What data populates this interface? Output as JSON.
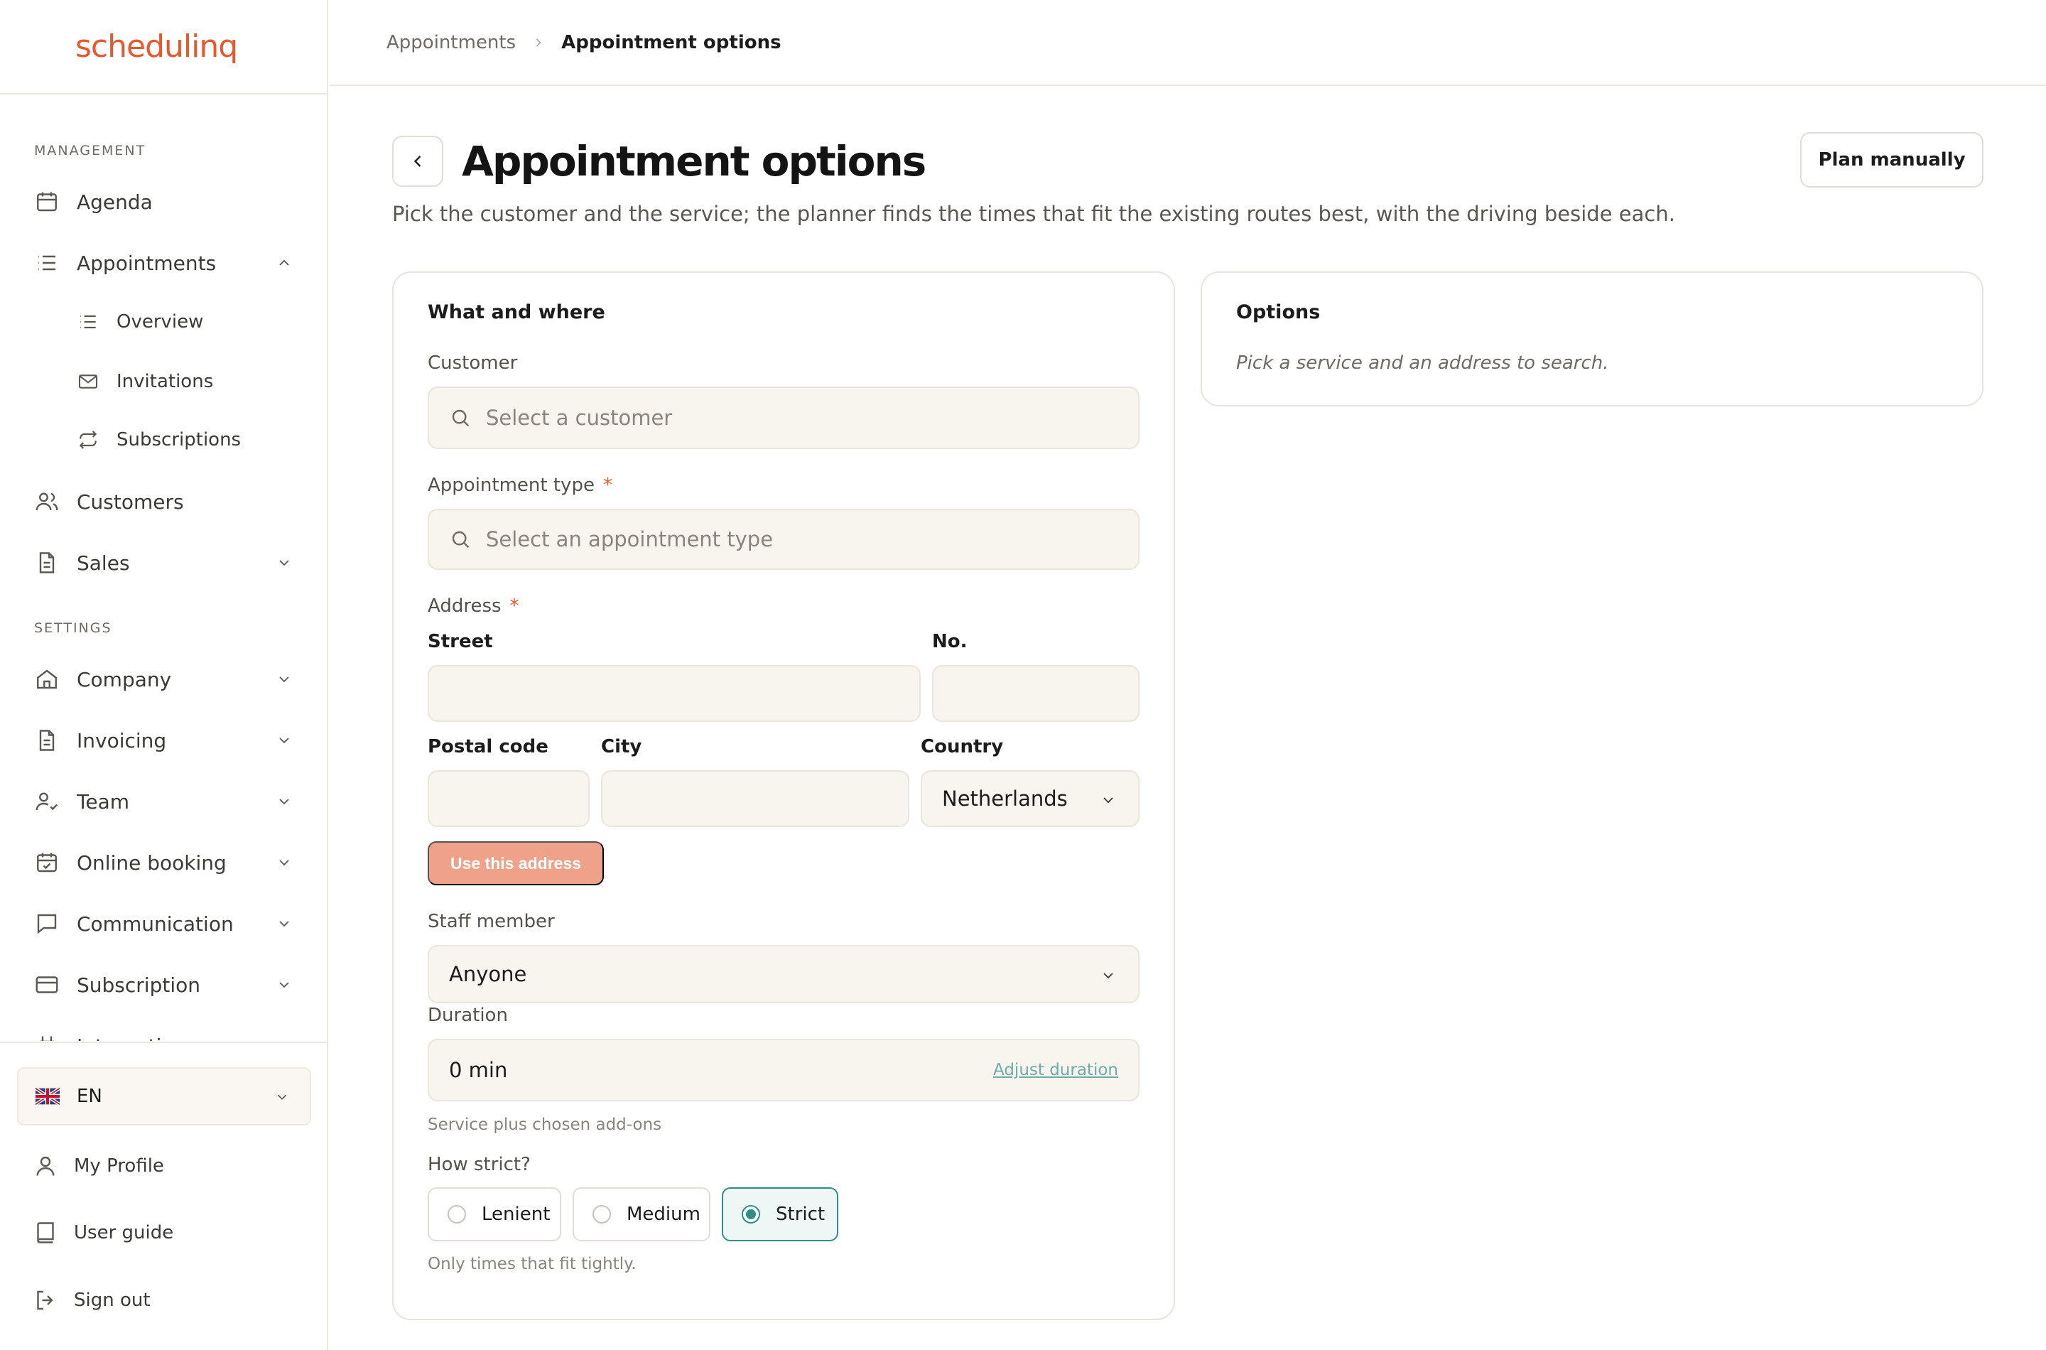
{
  "app": {
    "logo": "schedulinq"
  },
  "sidebar": {
    "management_label": "MANAGEMENT",
    "settings_label": "SETTINGS",
    "items": {
      "agenda": "Agenda",
      "appointments": "Appointments",
      "overview": "Overview",
      "invitations": "Invitations",
      "subscriptions": "Subscriptions",
      "customers": "Customers",
      "sales": "Sales",
      "company": "Company",
      "invoicing": "Invoicing",
      "team": "Team",
      "online_booking": "Online booking",
      "communication": "Communication",
      "subscription": "Subscription",
      "integrations": "Integrations"
    },
    "footer": {
      "language": "EN",
      "my_profile": "My Profile",
      "user_guide": "User guide",
      "sign_out": "Sign out"
    }
  },
  "breadcrumb": {
    "parent": "Appointments",
    "current": "Appointment options"
  },
  "page": {
    "title": "Appointment options",
    "description": "Pick the customer and the service; the planner finds the times that fit the existing routes best, with the driving beside each.",
    "plan_manually": "Plan manually"
  },
  "form": {
    "card_title": "What and where",
    "customer": {
      "label": "Customer",
      "placeholder": "Select a customer"
    },
    "appointment_type": {
      "label": "Appointment type",
      "required_mark": "*",
      "placeholder": "Select an appointment type"
    },
    "address": {
      "label": "Address",
      "required_mark": "*",
      "street_label": "Street",
      "number_label": "No.",
      "postal_label": "Postal code",
      "city_label": "City",
      "country_label": "Country",
      "country_value": "Netherlands",
      "use_button": "Use this address"
    },
    "staff": {
      "label": "Staff member",
      "value": "Anyone"
    },
    "duration": {
      "label": "Duration",
      "value": "0 min",
      "adjust_link": "Adjust duration",
      "helper": "Service plus chosen add-ons"
    },
    "strictness": {
      "label": "How strict?",
      "options": [
        "Lenient",
        "Medium",
        "Strict"
      ],
      "selected": "Strict",
      "helper": "Only times that fit tightly."
    }
  },
  "options_card": {
    "title": "Options",
    "hint": "Pick a service and an address to search."
  },
  "colors": {
    "brand": "#e8582c",
    "accent": "#2f8f87",
    "input_bg": "#f8f4ee",
    "disabled_button": "#f0a189"
  }
}
